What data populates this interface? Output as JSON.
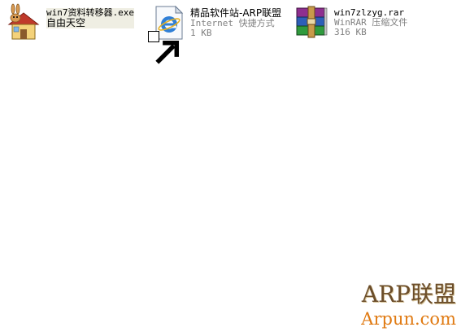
{
  "desktop": {
    "items": [
      {
        "name": "win7资料转移器.exe",
        "line2": "自由天空",
        "icon": "rabbit-house-icon"
      },
      {
        "name": "精品软件站-ARP联盟",
        "line2": "Internet 快捷方式",
        "line3": "1 KB",
        "icon": "internet-explorer-shortcut-icon"
      },
      {
        "name": "win7zlzyg.rar",
        "line2": "WinRAR 压缩文件",
        "line3": "316 KB",
        "icon": "winrar-archive-icon"
      }
    ]
  },
  "watermark": {
    "title": "ARP联盟",
    "url": "Arpun.com"
  },
  "colors": {
    "selection_bg": "#efeee3",
    "sub_text": "#808080",
    "watermark_title": "#6b4d2a",
    "watermark_url": "#e07a12"
  }
}
